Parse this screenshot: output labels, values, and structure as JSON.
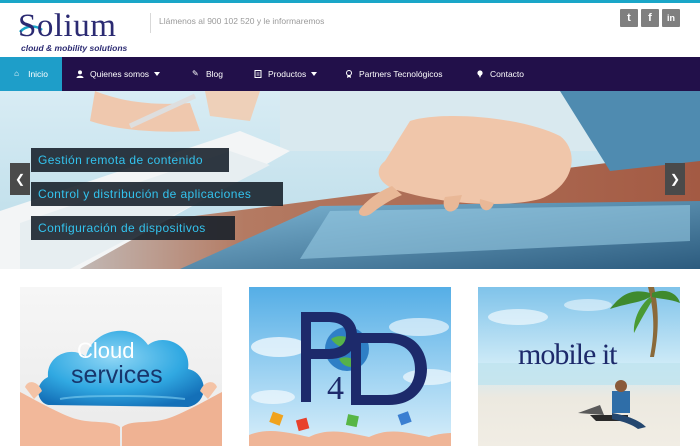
{
  "header": {
    "logo": {
      "word": "Solium",
      "tagline": "cloud & mobility solutions"
    },
    "phone_text": "Llámenos al 900 102 520 y le informaremos",
    "social": [
      {
        "name": "twitter",
        "glyph": "t"
      },
      {
        "name": "facebook",
        "glyph": "f"
      },
      {
        "name": "linkedin",
        "glyph": "in"
      }
    ]
  },
  "nav": {
    "items": [
      {
        "label": "Inicio",
        "icon": "home-icon",
        "active": true
      },
      {
        "label": "Quienes somos",
        "icon": "user-icon",
        "dropdown": true
      },
      {
        "label": "Blog",
        "icon": "pencil-icon"
      },
      {
        "label": "Productos",
        "icon": "document-icon",
        "dropdown": true
      },
      {
        "label": "Partners Tecnológicos",
        "icon": "award-icon"
      },
      {
        "label": "Contacto",
        "icon": "pin-icon"
      }
    ]
  },
  "hero": {
    "captions": [
      "Gestión remota de contenido",
      "Control y distribución de aplicaciones",
      "Configuración de dispositivos"
    ],
    "prev_glyph": "❮",
    "next_glyph": "❯"
  },
  "cards": [
    {
      "name": "cloud-services",
      "text_line1": "Cloud",
      "text_line2": "services"
    },
    {
      "name": "p4d",
      "text": "P4D"
    },
    {
      "name": "mobile-it",
      "text": "mobile it"
    }
  ],
  "colors": {
    "accent": "#1e9ec9",
    "nav_bg": "#22104a",
    "brand": "#2b2a72",
    "caption_text": "#33c3ee"
  }
}
